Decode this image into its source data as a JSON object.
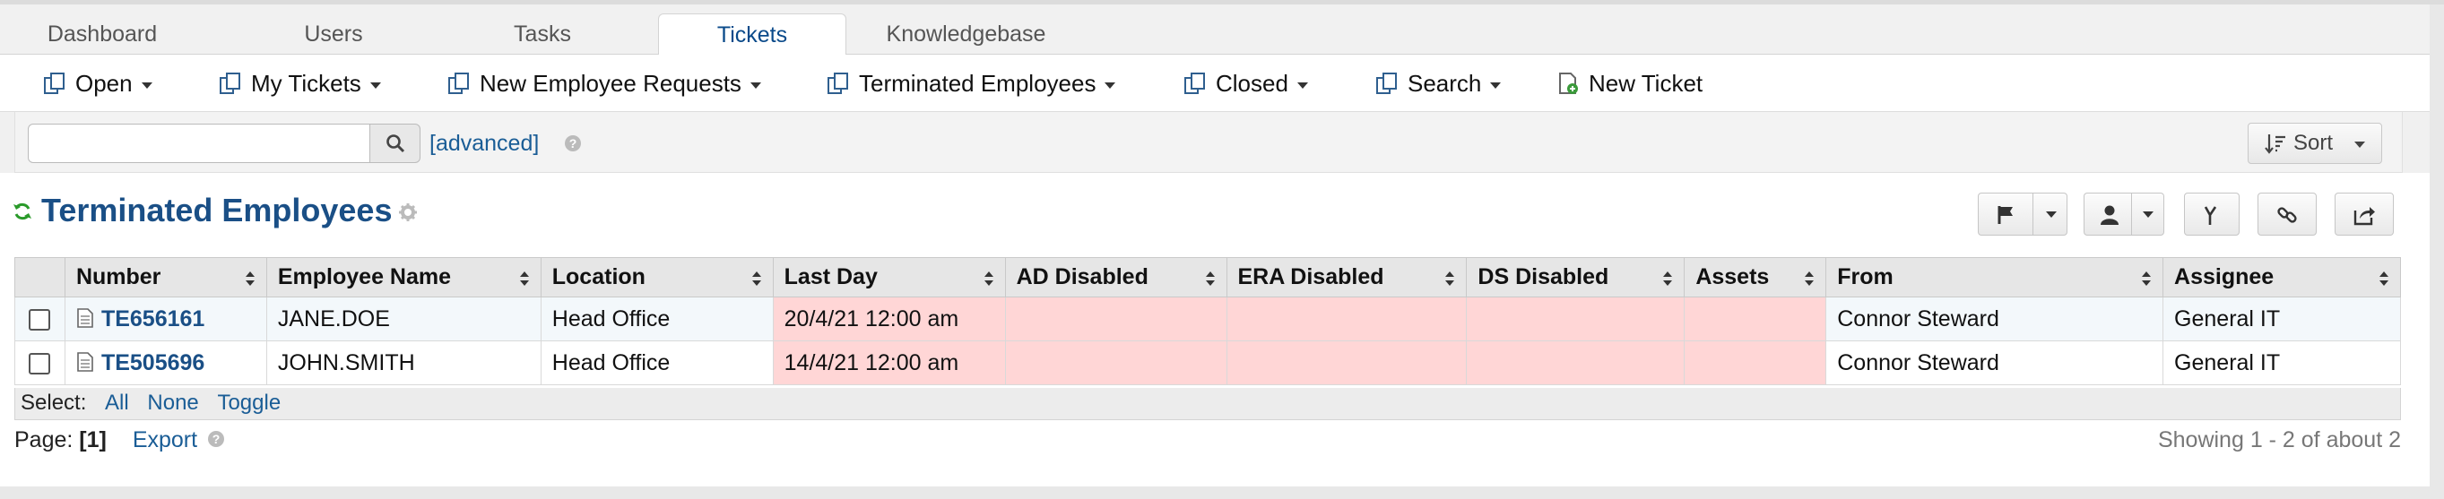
{
  "tabs": [
    {
      "label": "Dashboard",
      "active": false
    },
    {
      "label": "Users",
      "active": false
    },
    {
      "label": "Tasks",
      "active": false
    },
    {
      "label": "Tickets",
      "active": true
    },
    {
      "label": "Knowledgebase",
      "active": false
    }
  ],
  "subnav": {
    "open": "Open",
    "my_tickets": "My Tickets",
    "new_employee_requests": "New Employee Requests",
    "terminated_employees": "Terminated Employees",
    "closed": "Closed",
    "search": "Search",
    "new_ticket": "New Ticket"
  },
  "search": {
    "value": "",
    "placeholder": "",
    "advanced_label": "[advanced]",
    "sort_label": "Sort"
  },
  "page": {
    "title": "Terminated Employees"
  },
  "table": {
    "headers": [
      "Number",
      "Employee Name",
      "Location",
      "Last Day",
      "AD Disabled",
      "ERA Disabled",
      "DS Disabled",
      "Assets",
      "From",
      "Assignee"
    ],
    "rows": [
      {
        "number": "TE656161",
        "employee_name": "JANE.DOE",
        "location": "Head Office",
        "last_day": "20/4/21 12:00 am",
        "ad_disabled": "",
        "era_disabled": "",
        "ds_disabled": "",
        "assets": "",
        "from": "Connor Steward",
        "assignee": "General IT"
      },
      {
        "number": "TE505696",
        "employee_name": "JOHN.SMITH",
        "location": "Head Office",
        "last_day": "14/4/21 12:00 am",
        "ad_disabled": "",
        "era_disabled": "",
        "ds_disabled": "",
        "assets": "",
        "from": "Connor Steward",
        "assignee": "General IT"
      }
    ]
  },
  "select_bar": {
    "label": "Select:",
    "all": "All",
    "none": "None",
    "toggle": "Toggle"
  },
  "pager": {
    "label": "Page:",
    "current": "[1]",
    "export": "Export",
    "showing": "Showing 1 - 2 of about 2"
  },
  "colors": {
    "link": "#1a4f86",
    "highlight": "#ffd6d6",
    "row_alt": "#f3f8fb"
  }
}
